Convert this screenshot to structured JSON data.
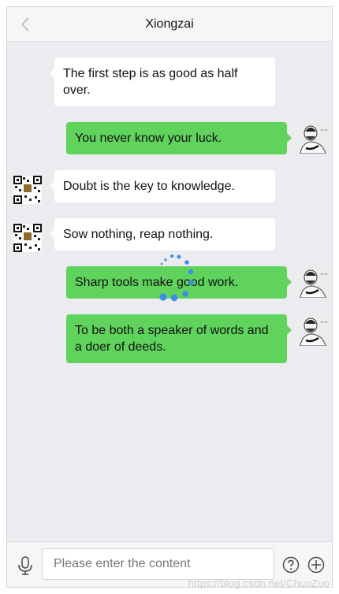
{
  "header": {
    "title": "Xiongzai",
    "back_icon": "chevron-left-icon"
  },
  "messages": [
    {
      "side": "left",
      "avatar": "qr-avatar",
      "text": "The first step is as good as half over."
    },
    {
      "side": "right",
      "avatar": "person-avatar",
      "text": "You never know your luck."
    },
    {
      "side": "left",
      "avatar": "qr-avatar",
      "text": "Doubt is the key to knowledge."
    },
    {
      "side": "left",
      "avatar": "qr-avatar",
      "text": "Sow nothing, reap nothing."
    },
    {
      "side": "right",
      "avatar": "person-avatar",
      "text": "Sharp tools make good work."
    },
    {
      "side": "right",
      "avatar": "person-avatar",
      "text": "To be both a speaker of words and a doer of deeds."
    }
  ],
  "composer": {
    "placeholder": "Please enter the content",
    "value": "",
    "mic_icon": "microphone-icon",
    "help_icon": "question-circle-icon",
    "add_icon": "plus-circle-icon"
  },
  "colors": {
    "sent_bubble": "#5fd35c",
    "received_bubble": "#ffffff",
    "chat_background": "#ebebf0",
    "spinner": "#3a8ee6"
  },
  "watermark": "https://blog.csdn.net/ChuoZuo"
}
